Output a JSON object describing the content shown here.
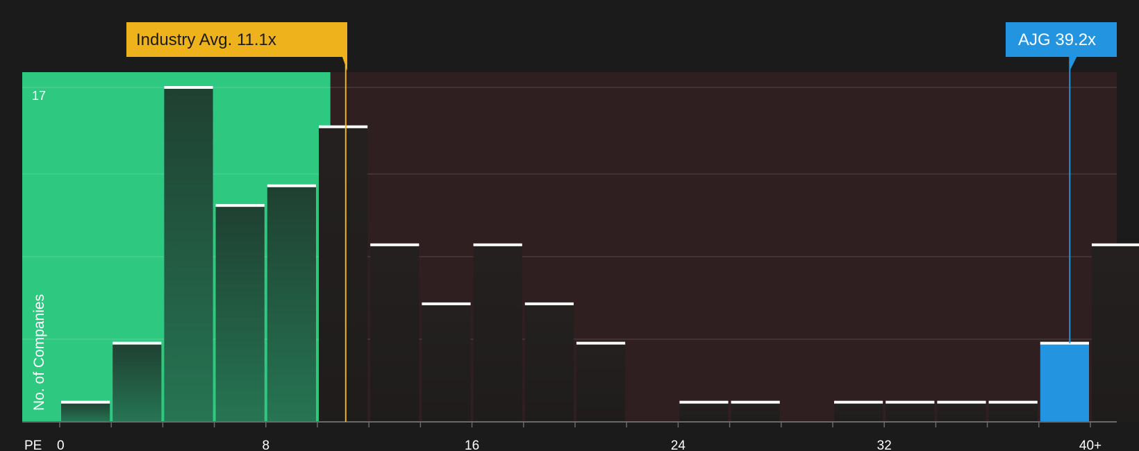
{
  "chart_data": {
    "type": "bar",
    "xlabel": "PE",
    "ylabel": "No. of Companies",
    "x_ticks": [
      "0",
      "8",
      "16",
      "24",
      "32",
      "40+"
    ],
    "y_tick_labels": [
      "17"
    ],
    "ylim": [
      0,
      17.6
    ],
    "bin_width": 2,
    "bins": [
      {
        "start": 0,
        "count": 1
      },
      {
        "start": 2,
        "count": 4
      },
      {
        "start": 4,
        "count": 17
      },
      {
        "start": 6,
        "count": 11
      },
      {
        "start": 8,
        "count": 12
      },
      {
        "start": 10,
        "count": 15
      },
      {
        "start": 12,
        "count": 9
      },
      {
        "start": 14,
        "count": 6
      },
      {
        "start": 16,
        "count": 9
      },
      {
        "start": 18,
        "count": 6
      },
      {
        "start": 20,
        "count": 4
      },
      {
        "start": 22,
        "count": 0
      },
      {
        "start": 24,
        "count": 1
      },
      {
        "start": 26,
        "count": 1
      },
      {
        "start": 28,
        "count": 0
      },
      {
        "start": 30,
        "count": 1
      },
      {
        "start": 32,
        "count": 1
      },
      {
        "start": 34,
        "count": 1
      },
      {
        "start": 36,
        "count": 1
      },
      {
        "start": 38,
        "count": 4,
        "highlight": true
      },
      {
        "start": 40,
        "count": 9
      }
    ],
    "industry_avg": {
      "value": 11.1,
      "label": "Industry Avg. 11.1x"
    },
    "company": {
      "value": 39.2,
      "label": "AJG 39.2x"
    },
    "colors": {
      "background": "#1b1b1b",
      "green_zone": "#2ec880",
      "red_zone": "#2f1f20",
      "industry": "#eeb31c",
      "company": "#2394e0",
      "bar_cap": "#ffffff"
    }
  }
}
